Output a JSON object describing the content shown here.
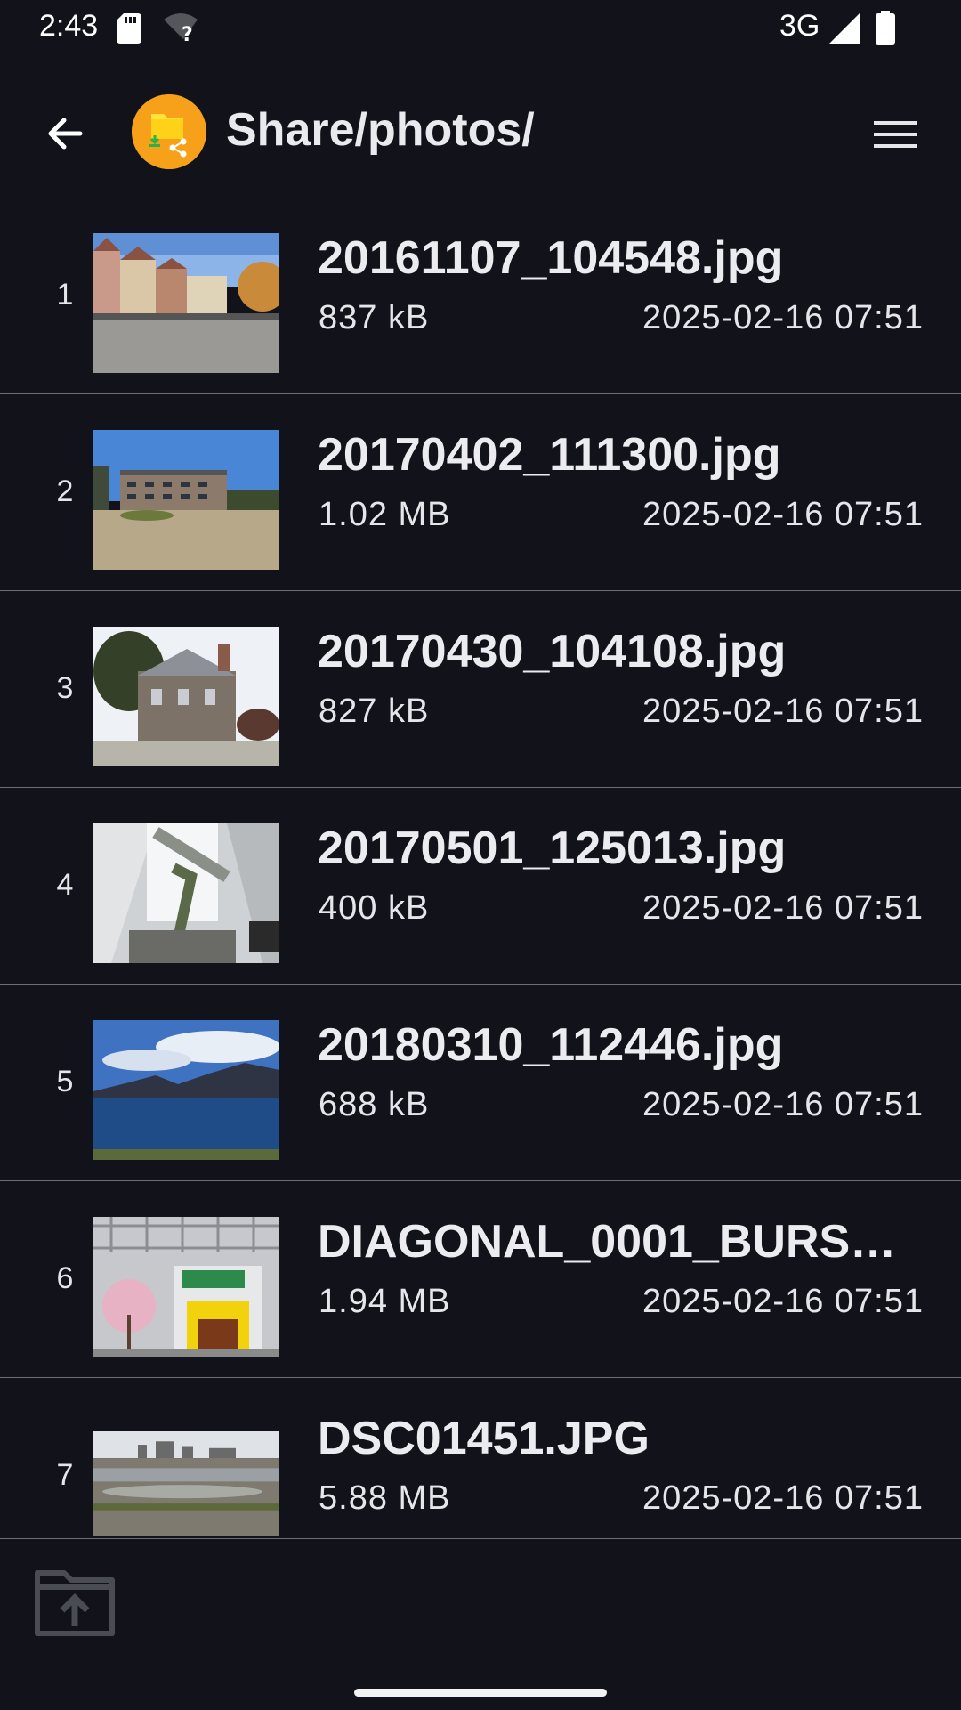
{
  "status_bar": {
    "time": "2:43",
    "network": "3G",
    "icons": [
      "sd-card-icon",
      "wifi-unknown-icon",
      "signal-icon",
      "battery-icon"
    ]
  },
  "app_bar": {
    "title": "Share/photos/",
    "back_icon": "arrow-back-icon",
    "logo_icon": "shared-folder-icon",
    "menu_icon": "hamburger-menu-icon"
  },
  "files": [
    {
      "index": "1",
      "name": "20161107_104548.jpg",
      "size": "837 kB",
      "date": "2025-02-16 07:51"
    },
    {
      "index": "2",
      "name": "20170402_111300.jpg",
      "size": "1.02 MB",
      "date": "2025-02-16 07:51"
    },
    {
      "index": "3",
      "name": "20170430_104108.jpg",
      "size": "827 kB",
      "date": "2025-02-16 07:51"
    },
    {
      "index": "4",
      "name": "20170501_125013.jpg",
      "size": "400 kB",
      "date": "2025-02-16 07:51"
    },
    {
      "index": "5",
      "name": "20180310_112446.jpg",
      "size": "688 kB",
      "date": "2025-02-16 07:51"
    },
    {
      "index": "6",
      "name": "DIAGONAL_0001_BURS…",
      "size": "1.94 MB",
      "date": "2025-02-16 07:51"
    },
    {
      "index": "7",
      "name": "DSC01451.JPG",
      "size": "5.88 MB",
      "date": "2025-02-16 07:51"
    }
  ],
  "bottom_bar": {
    "upload_icon": "folder-upload-icon"
  },
  "colors": {
    "background": "#12131a",
    "divider": "#6d6e74",
    "logo": "#f7a11a"
  }
}
